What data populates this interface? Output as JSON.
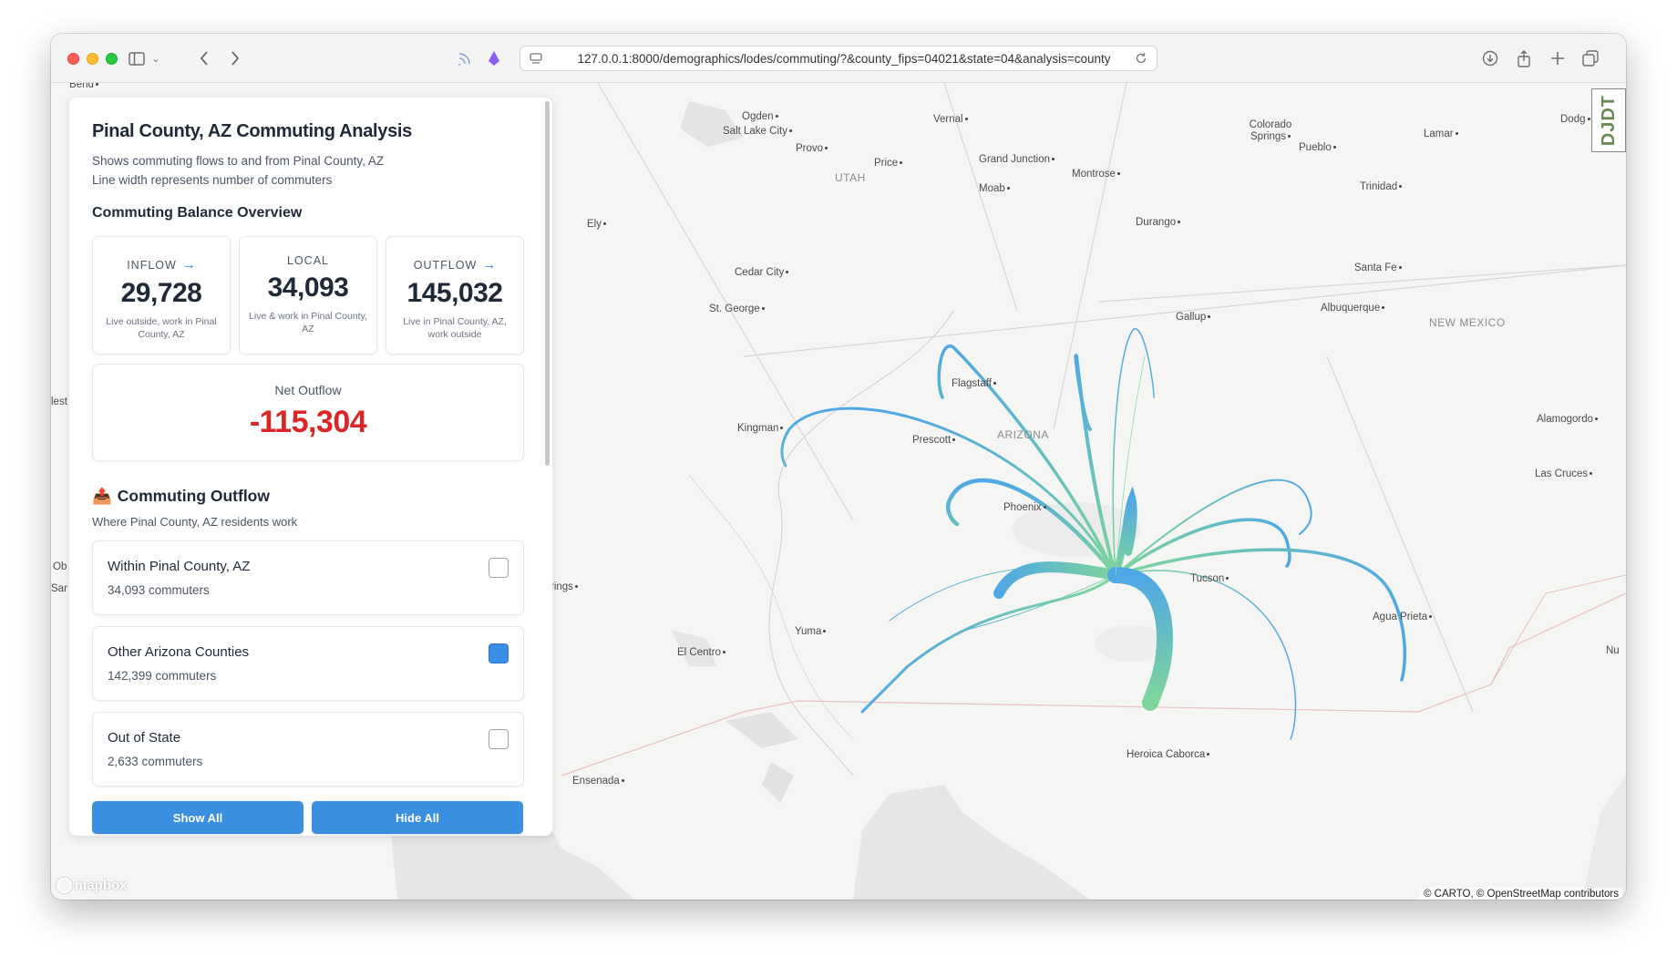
{
  "browser": {
    "url": "127.0.0.1:8000/demographics/lodes/commuting/?&county_fips=04021&state=04&analysis=county"
  },
  "panel": {
    "title": "Pinal County, AZ Commuting Analysis",
    "subtitle_line1": "Shows commuting flows to and from Pinal County, AZ",
    "subtitle_line2": "Line width represents number of commuters",
    "balance_title": "Commuting Balance Overview",
    "stats": [
      {
        "label": "INFLOW",
        "arrow": "→",
        "value": "29,728",
        "desc": "Live outside, work in Pinal County, AZ"
      },
      {
        "label": "LOCAL",
        "arrow": "",
        "value": "34,093",
        "desc": "Live & work in Pinal County, AZ"
      },
      {
        "label": "OUTFLOW",
        "arrow": "→",
        "value": "145,032",
        "desc": "Live in Pinal County, AZ, work outside"
      }
    ],
    "net": {
      "label": "Net Outflow",
      "value": "-115,304",
      "color": "#dc2626"
    },
    "outflow_emoji": "📤",
    "outflow_title": "Commuting Outflow",
    "outflow_subtitle": "Where Pinal County, AZ residents work",
    "flows": [
      {
        "name": "Within Pinal County, AZ",
        "count": "34,093 commuters",
        "checked": false
      },
      {
        "name": "Other Arizona Counties",
        "count": "142,399 commuters",
        "checked": true
      },
      {
        "name": "Out of State",
        "count": "2,633 commuters",
        "checked": false
      }
    ],
    "show_all": "Show All",
    "hide_all": "Hide All"
  },
  "map": {
    "cities": [
      "Bend",
      "Ogden",
      "Salt Lake City",
      "Provo",
      "Vernal",
      "Price",
      "Grand Junction",
      "Moab",
      "Montrose",
      "Colorado Springs",
      "Pueblo",
      "Lamar",
      "Dodg",
      "Trinidad",
      "Durango",
      "Ely",
      "Cedar City",
      "St. George",
      "Gallup",
      "Santa Fe",
      "Albuquerque",
      "Flagstaff",
      "Kingman",
      "Prescott",
      "Phoenix",
      "Tucson",
      "Agua Prieta",
      "Yuma",
      "El Centro",
      "Alamogordo",
      "Las Cruces",
      "Heroica Caborca",
      "Ensenada",
      "rings",
      "Ob",
      "Sar",
      "lest",
      "Nu"
    ],
    "states": [
      "UTAH",
      "NEW MEXICO",
      "ARIZONA"
    ],
    "logo": "mapbox",
    "attribution": "© CARTO, © OpenStreetMap contributors",
    "djdt": "DJDT",
    "flow_colors": {
      "near": "#7fd69a",
      "far": "#4fa7e6"
    }
  }
}
